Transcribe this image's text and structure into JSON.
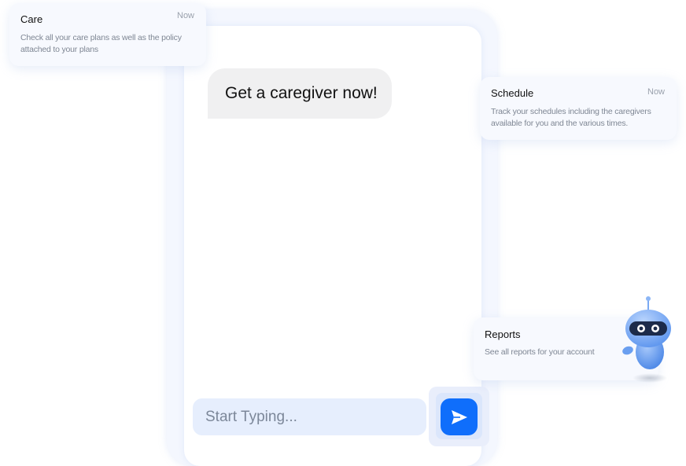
{
  "chat": {
    "bubble_text": "Get a caregiver now!",
    "input_placeholder": "Start Typing..."
  },
  "cards": {
    "care": {
      "title": "Care",
      "time": "Now",
      "description": "Check all your care plans as well as the policy attached to your plans"
    },
    "schedule": {
      "title": "Schedule",
      "time": "Now",
      "description": "Track your schedules including the caregivers available for you and the various times."
    },
    "reports": {
      "title": "Reports",
      "description": "See all reports for your account"
    }
  },
  "colors": {
    "accent": "#0f6efb",
    "input_bg": "#e6eefd",
    "robot_body": "#5b97ee"
  },
  "icons": {
    "send": "send-icon",
    "robot": "robot-mascot-icon"
  }
}
